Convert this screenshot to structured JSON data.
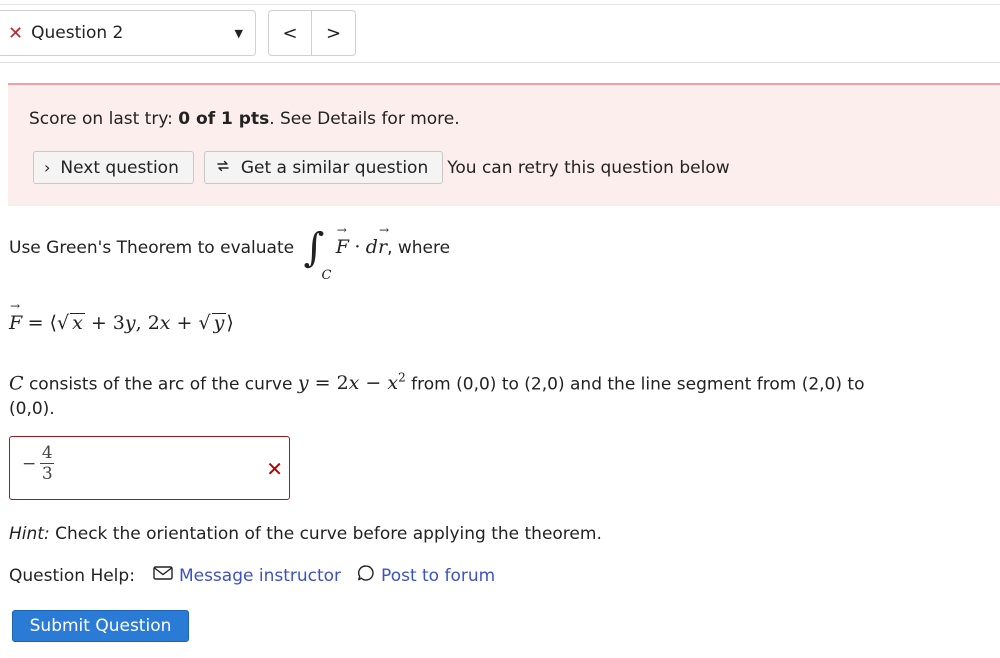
{
  "header": {
    "question_select_label": "Question 2",
    "prev_glyph": "<",
    "next_glyph": ">"
  },
  "score": {
    "prefix": "Score on last try: ",
    "value": "0 of 1 pts",
    "suffix": ". See Details for more.",
    "next_label": "Next question",
    "similar_label": "Get a similar question",
    "retry_text": "You can retry this question below"
  },
  "problem": {
    "intro": "Use Green's Theorem to evaluate",
    "where": ", where",
    "curve_sub": "C",
    "field_F": "F",
    "dr": "dr",
    "c_letter": "C",
    "c_text_1": " consists of the arc of the curve ",
    "c_text_2": " from (0,0) to (2,0) and the line segment from (2,0) to",
    "c_text_3": "(0,0)."
  },
  "answer": {
    "sign": "−",
    "numerator": "4",
    "denominator": "3",
    "status": "incorrect"
  },
  "hint": {
    "label": "Hint:",
    "text": " Check the orientation of the curve before applying the theorem."
  },
  "help": {
    "label": "Question Help:",
    "message_link": "Message instructor",
    "forum_link": "Post to forum"
  },
  "submit_label": "Submit Question",
  "colors": {
    "error_red": "#c0282d",
    "score_bg": "#fdeeee",
    "link_blue": "#3c51c7",
    "submit_blue": "#2a7bd5"
  }
}
